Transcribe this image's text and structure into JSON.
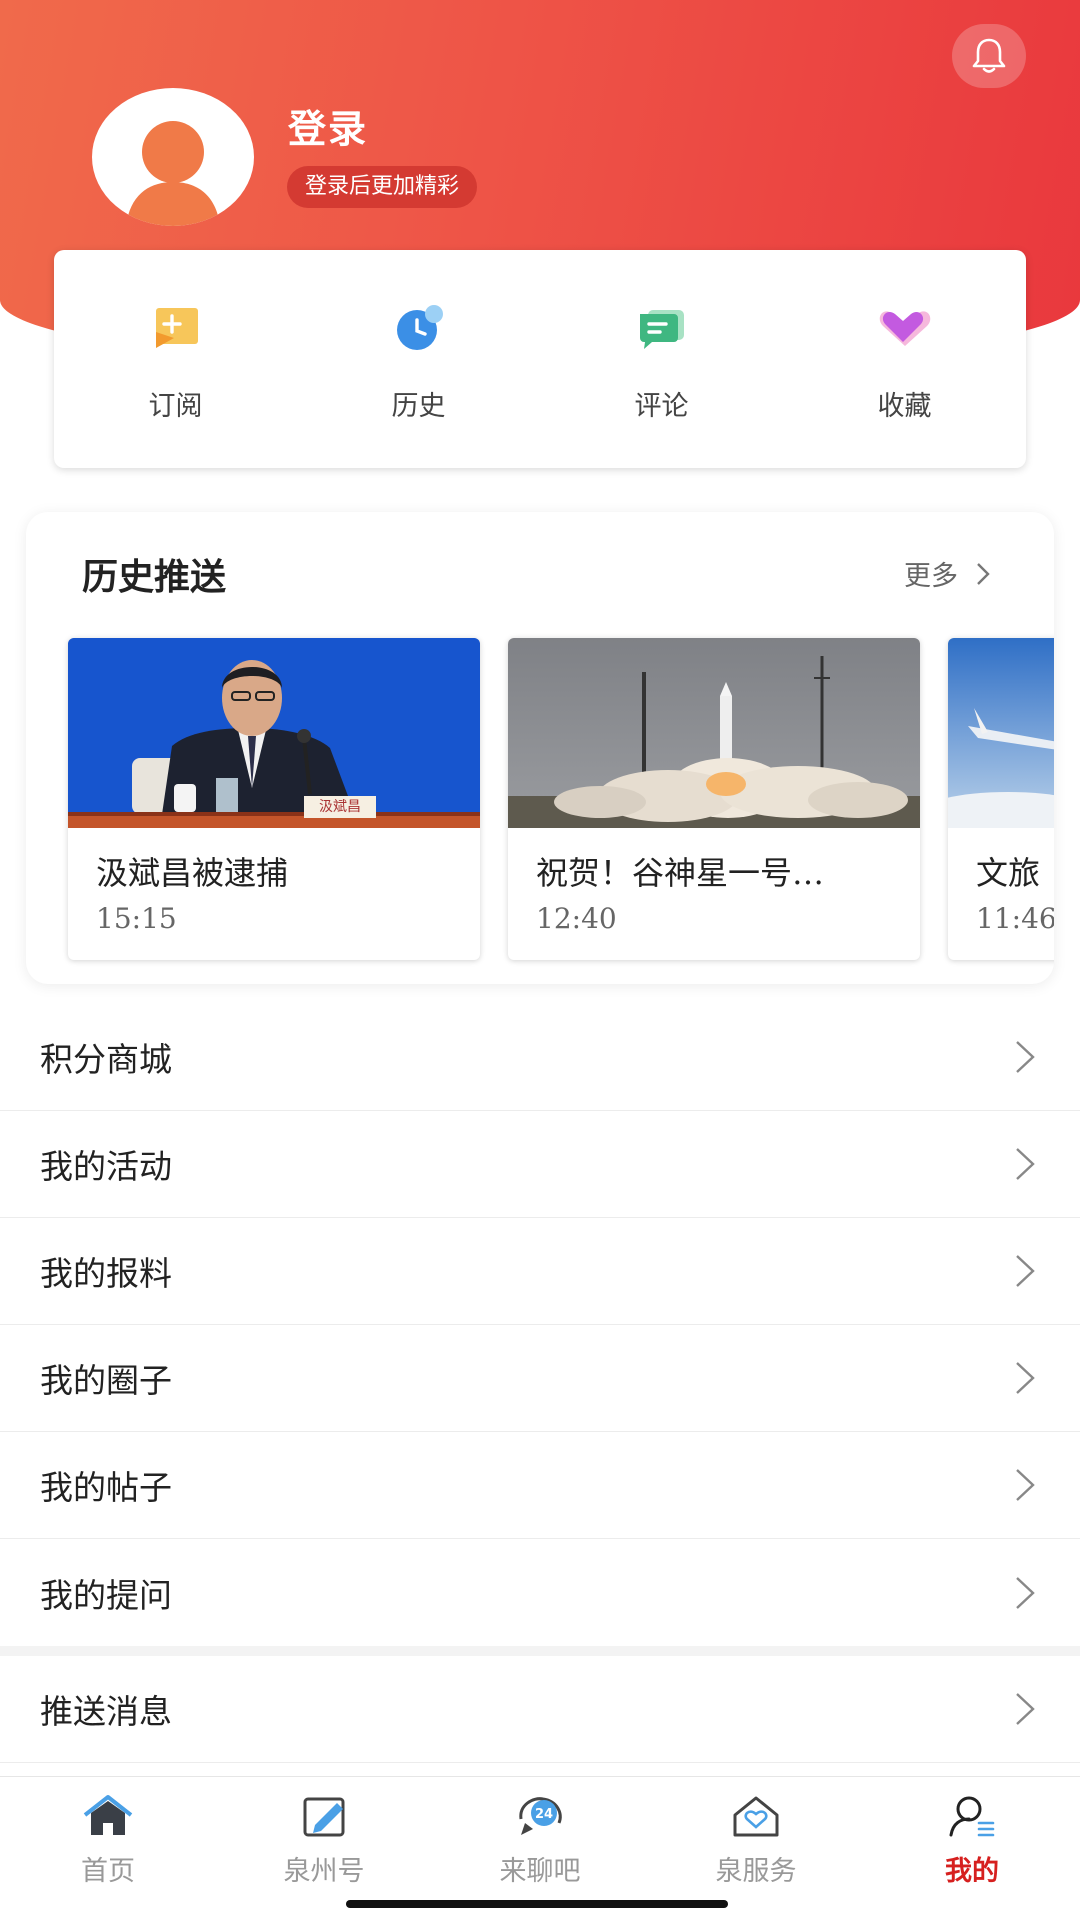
{
  "header": {
    "login_title": "登录",
    "login_subtitle": "登录后更加精彩",
    "accent_color": "#ee4b44"
  },
  "quick_actions": [
    {
      "label": "订阅",
      "icon": "subscribe-icon"
    },
    {
      "label": "历史",
      "icon": "history-clock-icon"
    },
    {
      "label": "评论",
      "icon": "comment-icon"
    },
    {
      "label": "收藏",
      "icon": "favorite-heart-icon"
    }
  ],
  "history_push": {
    "title": "历史推送",
    "more_label": "更多",
    "items": [
      {
        "title": "汲斌昌被逮捕",
        "time": "15:15",
        "image": "press-conference-photo"
      },
      {
        "title": "祝贺！谷神星一号…",
        "time": "12:40",
        "image": "rocket-launch-photo"
      },
      {
        "title": "文旅",
        "time": "11:46",
        "image": "airplane-sky-photo"
      }
    ],
    "nameplate_text": "汲斌昌"
  },
  "menu": {
    "items": [
      "积分商城",
      "我的活动",
      "我的报料",
      "我的圈子",
      "我的帖子",
      "我的提问"
    ],
    "extra": "推送消息"
  },
  "tabbar": {
    "items": [
      {
        "label": "首页",
        "icon": "home-icon"
      },
      {
        "label": "泉州号",
        "icon": "edit-icon"
      },
      {
        "label": "来聊吧",
        "icon": "chat-24-icon"
      },
      {
        "label": "泉服务",
        "icon": "service-house-icon"
      },
      {
        "label": "我的",
        "icon": "profile-icon",
        "active": true
      }
    ],
    "active_color": "#d6201f"
  }
}
